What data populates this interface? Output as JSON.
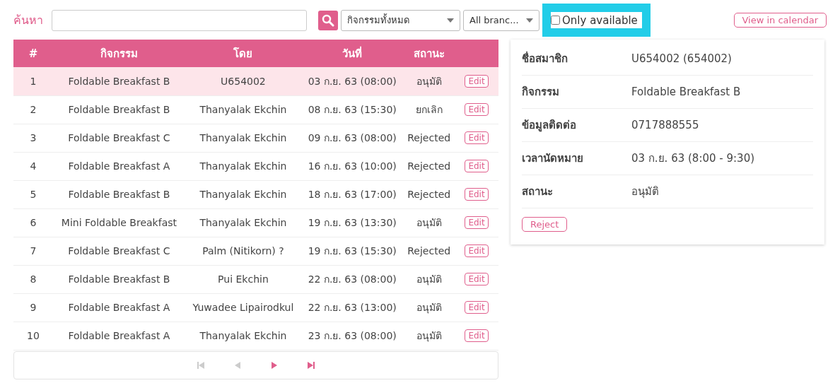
{
  "search": {
    "label": "ค้นหา"
  },
  "filters": {
    "activity": "กิจกรรมทั้งหมด",
    "branch": "All branc...",
    "only_available": {
      "label": "Only available",
      "checked": false,
      "highlighted": true
    }
  },
  "view_calendar": "View in calendar",
  "table": {
    "columns": [
      "#",
      "กิจกรรม",
      "โดย",
      "วันที่",
      "สถานะ"
    ],
    "rows": [
      {
        "no": "1",
        "activity": "Foldable Breakfast B",
        "by": "U654002",
        "date": "03 ก.ย. 63 (08:00)",
        "status": "อนุมัติ",
        "action": "Edit",
        "selected": true
      },
      {
        "no": "2",
        "activity": "Foldable Breakfast B",
        "by": "Thanyalak Ekchin",
        "date": "08 ก.ย. 63 (15:30)",
        "status": "ยกเลิก",
        "action": "Edit",
        "selected": false
      },
      {
        "no": "3",
        "activity": "Foldable Breakfast C",
        "by": "Thanyalak Ekchin",
        "date": "09 ก.ย. 63 (08:00)",
        "status": "Rejected",
        "action": "Edit",
        "selected": false
      },
      {
        "no": "4",
        "activity": "Foldable Breakfast A",
        "by": "Thanyalak Ekchin",
        "date": "16 ก.ย. 63 (10:00)",
        "status": "Rejected",
        "action": "Edit",
        "selected": false
      },
      {
        "no": "5",
        "activity": "Foldable Breakfast B",
        "by": "Thanyalak Ekchin",
        "date": "18 ก.ย. 63 (17:00)",
        "status": "Rejected",
        "action": "Edit",
        "selected": false
      },
      {
        "no": "6",
        "activity": "Mini Foldable Breakfast",
        "by": "Thanyalak Ekchin",
        "date": "19 ก.ย. 63 (13:30)",
        "status": "อนุมัติ",
        "action": "Edit",
        "selected": false
      },
      {
        "no": "7",
        "activity": "Foldable Breakfast C",
        "by": "Palm (Nitikorn) ?",
        "date": "19 ก.ย. 63 (15:30)",
        "status": "Rejected",
        "action": "Edit",
        "selected": false
      },
      {
        "no": "8",
        "activity": "Foldable Breakfast B",
        "by": "Pui Ekchin",
        "date": "22 ก.ย. 63 (08:00)",
        "status": "อนุมัติ",
        "action": "Edit",
        "selected": false
      },
      {
        "no": "9",
        "activity": "Foldable Breakfast A",
        "by": "Yuwadee Lipairodkul",
        "date": "22 ก.ย. 63 (13:00)",
        "status": "อนุมัติ",
        "action": "Edit",
        "selected": false
      },
      {
        "no": "10",
        "activity": "Foldable Breakfast A",
        "by": "Thanyalak Ekchin",
        "date": "23 ก.ย. 63 (08:00)",
        "status": "อนุมัติ",
        "action": "Edit",
        "selected": false
      }
    ]
  },
  "pagination": [
    {
      "kind": "first",
      "disabled": true
    },
    {
      "kind": "prev",
      "disabled": true
    },
    {
      "kind": "next",
      "disabled": false
    },
    {
      "kind": "last",
      "disabled": false
    }
  ],
  "detail": {
    "fields": [
      {
        "label": "ชื่อสมาชิก",
        "value": "U654002 (654002)"
      },
      {
        "label": "กิจกรรม",
        "value": "Foldable Breakfast B"
      },
      {
        "label": "ข้อมูลติดต่อ",
        "value": "0717888555"
      },
      {
        "label": "เวลานัดหมาย",
        "value": "03 ก.ย. 63 (8:00 - 9:30)"
      },
      {
        "label": "สถานะ",
        "value": "อนุมัติ"
      }
    ],
    "button": "Reject"
  }
}
